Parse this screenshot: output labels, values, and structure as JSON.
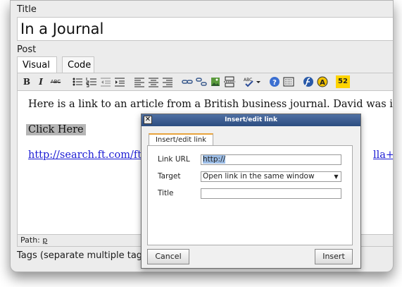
{
  "form": {
    "title_label": "Title",
    "title_value": "In a Journal",
    "post_label": "Post",
    "tabs": [
      {
        "label": "Visual"
      },
      {
        "label": "Code"
      }
    ],
    "tags_label": "Tags (separate multiple tags"
  },
  "toolbar": {
    "bold": "B",
    "italic": "I",
    "strike": "ABC",
    "more_label": "52"
  },
  "editor": {
    "paragraph_1": "Here is a link to an article from a British business journal. David was inter",
    "click_here": "Click Here",
    "link_text": "http://search.ft.com/ftA",
    "link_tail": "lla+br",
    "path_label": "Path:",
    "path_value": "p"
  },
  "dialog": {
    "title": "Insert/edit link",
    "close": "✕",
    "tab_label": "Insert/edit link",
    "url_label": "Link URL",
    "url_value": "http://",
    "target_label": "Target",
    "target_value": "Open link in the same window",
    "title_label": "Title",
    "title_value": "",
    "cancel_label": "Cancel",
    "insert_label": "Insert"
  },
  "colors": {
    "dialog_titlebar": "#3a5a8d",
    "link": "#1c1cd4",
    "tab_accent": "#e8a33c"
  }
}
